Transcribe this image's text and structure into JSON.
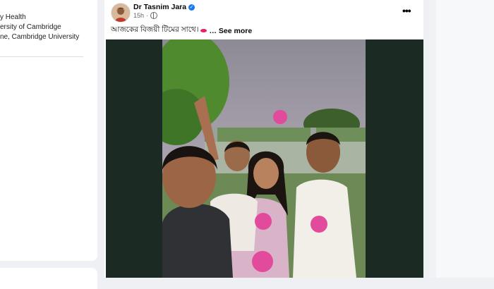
{
  "left_card": {
    "lines": [
      "y Health",
      "ersity of Cambridge",
      "ne, Cambridge University"
    ]
  },
  "post": {
    "author": "Dr Tasnim Jara",
    "time": "15h",
    "text": "আজকের বিজয়ী টিমের সাথে।",
    "see_more": "… See more",
    "more_icon": "•••"
  },
  "colors": {
    "accent": "#1877f2",
    "media_bg": "#1b2a22"
  }
}
